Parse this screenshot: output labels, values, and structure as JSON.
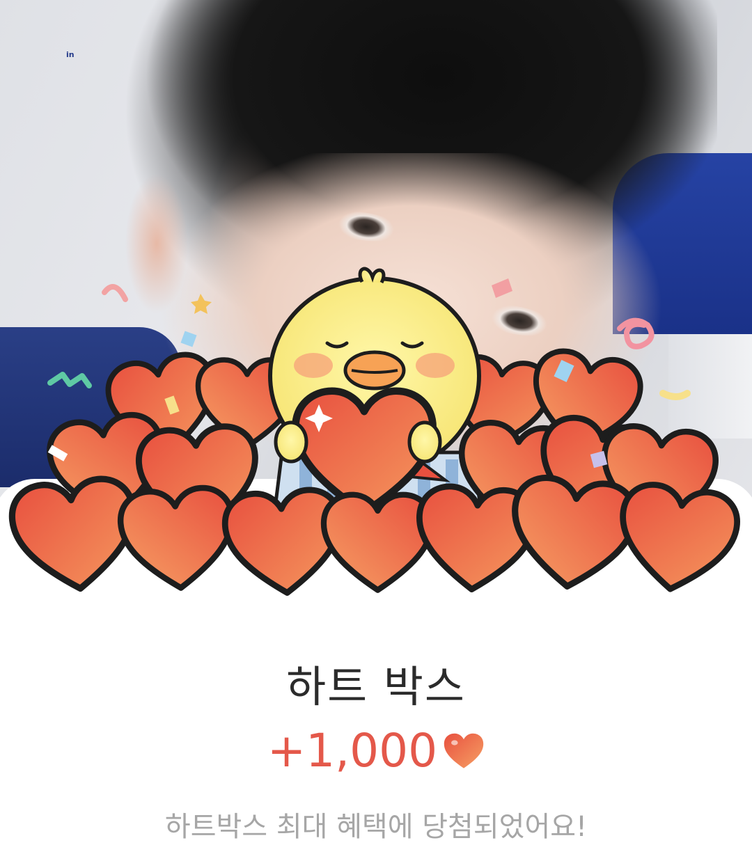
{
  "photo": {
    "watermark": "in"
  },
  "illustration": {
    "icons": [
      "confetti-icon",
      "chick-character",
      "heart-icon",
      "gift-box-icon"
    ]
  },
  "reward_card": {
    "title": "하트 박스",
    "amount": "+1,000",
    "amount_icon": "heart-icon",
    "message": "하트박스 최대 혜택에 당첨되었어요!"
  },
  "colors": {
    "accent": "#e4584a",
    "heart_light": "#f58a5a",
    "heart_dark": "#e64f44",
    "title": "#2b2b2b",
    "subtitle": "#a6a6a6"
  }
}
